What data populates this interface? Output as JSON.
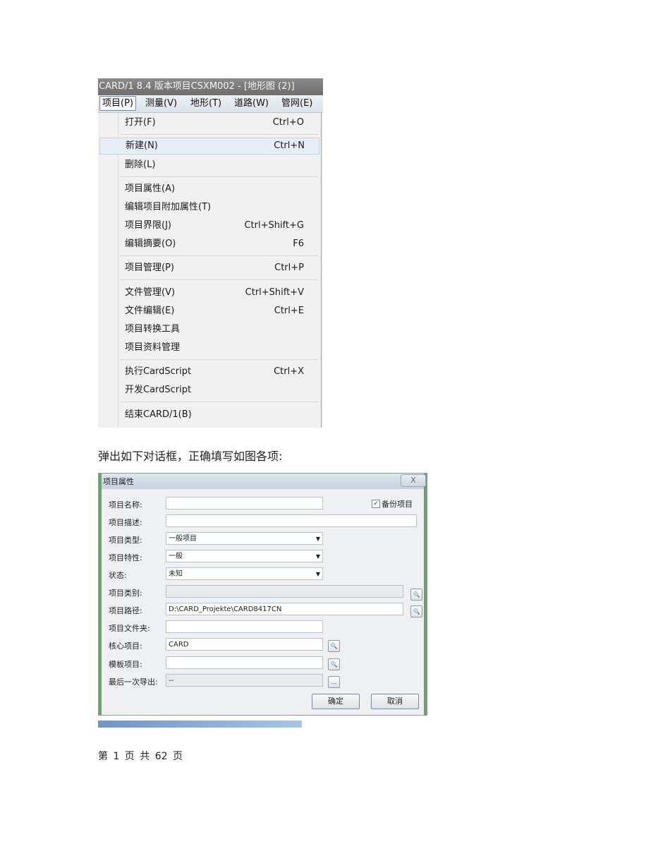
{
  "menu_screenshot": {
    "title": "CARD/1 8.4 版本项目CSXM002 - [地形图 (2)]",
    "menubar": [
      "项目(P)",
      "测量(V)",
      "地形(T)",
      "道路(W)",
      "管网(E)"
    ],
    "items": [
      {
        "label": "打开(F)",
        "shortcut": "Ctrl+O"
      },
      {
        "label": "新建(N)",
        "shortcut": "Ctrl+N"
      },
      {
        "label": "删除(L)",
        "shortcut": ""
      },
      {
        "label": "项目属性(A)",
        "shortcut": ""
      },
      {
        "label": "编辑项目附加属性(T)",
        "shortcut": ""
      },
      {
        "label": "项目界限(J)",
        "shortcut": "Ctrl+Shift+G"
      },
      {
        "label": "编辑摘要(O)",
        "shortcut": "F6"
      },
      {
        "label": "项目管理(P)",
        "shortcut": "Ctrl+P"
      },
      {
        "label": "文件管理(V)",
        "shortcut": "Ctrl+Shift+V"
      },
      {
        "label": "文件编辑(E)",
        "shortcut": "Ctrl+E"
      },
      {
        "label": "项目转换工具",
        "shortcut": ""
      },
      {
        "label": "项目资料管理",
        "shortcut": ""
      },
      {
        "label": "执行CardScript",
        "shortcut": "Ctrl+X"
      },
      {
        "label": "开发CardScript",
        "shortcut": ""
      },
      {
        "label": "结束CARD/1(B)",
        "shortcut": ""
      }
    ]
  },
  "caption": "弹出如下对话框，正确填写如图各项:",
  "dialog": {
    "title": "项目属性",
    "close": "X",
    "backup_checkbox": {
      "label": "备份项目",
      "checked": true,
      "mark": "✓"
    },
    "fields": [
      {
        "label": "项目名称:",
        "value": ""
      },
      {
        "label": "项目描述:",
        "value": ""
      },
      {
        "label": "项目类型:",
        "value": "一般项目"
      },
      {
        "label": "项目特性:",
        "value": "一般"
      },
      {
        "label": "状态:",
        "value": "未知"
      },
      {
        "label": "项目类别:",
        "value": ""
      },
      {
        "label": "项目路径:",
        "value": "D:\\CARD_Projekte\\CARD8417CN"
      },
      {
        "label": "项目文件夹:",
        "value": ""
      },
      {
        "label": "核心项目:",
        "value": "CARD"
      },
      {
        "label": "模板项目:",
        "value": ""
      },
      {
        "label": "最后一次导出:",
        "value": "--"
      }
    ],
    "dropdown_arrow": "▼",
    "browse_icon": "🔍",
    "ellipsis": "...",
    "ok": "确定",
    "cancel": "取消"
  },
  "footer": "第 1 页 共 62 页"
}
